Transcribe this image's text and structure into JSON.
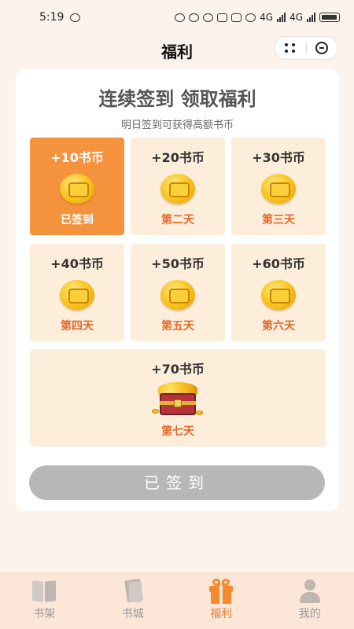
{
  "status_bar": {
    "time": "5:19",
    "network": "4G"
  },
  "header": {
    "title": "福利"
  },
  "checkin": {
    "title": "连续签到 领取福利",
    "subtitle": "明日签到可获得高额书币",
    "days": [
      {
        "coins": "+10书币",
        "label": "已签到",
        "checked": true
      },
      {
        "coins": "+20书币",
        "label": "第二天",
        "checked": false
      },
      {
        "coins": "+30书币",
        "label": "第三天",
        "checked": false
      },
      {
        "coins": "+40书币",
        "label": "第四天",
        "checked": false
      },
      {
        "coins": "+50书币",
        "label": "第五天",
        "checked": false
      },
      {
        "coins": "+60书币",
        "label": "第六天",
        "checked": false
      },
      {
        "coins": "+70书币",
        "label": "第七天",
        "checked": false
      }
    ],
    "button_label": "已签到"
  },
  "colors": {
    "accent": "#f5923e",
    "day_bg": "#fdeedb",
    "day_text": "#e06a2a",
    "disabled_button": "#b7b7b7",
    "tab_bar_bg": "#fbe6d7"
  },
  "tabs": [
    {
      "label": "书架",
      "icon": "bookshelf-icon",
      "active": false
    },
    {
      "label": "书城",
      "icon": "bookstore-icon",
      "active": false
    },
    {
      "label": "福利",
      "icon": "gift-icon",
      "active": true
    },
    {
      "label": "我的",
      "icon": "user-icon",
      "active": false
    }
  ]
}
